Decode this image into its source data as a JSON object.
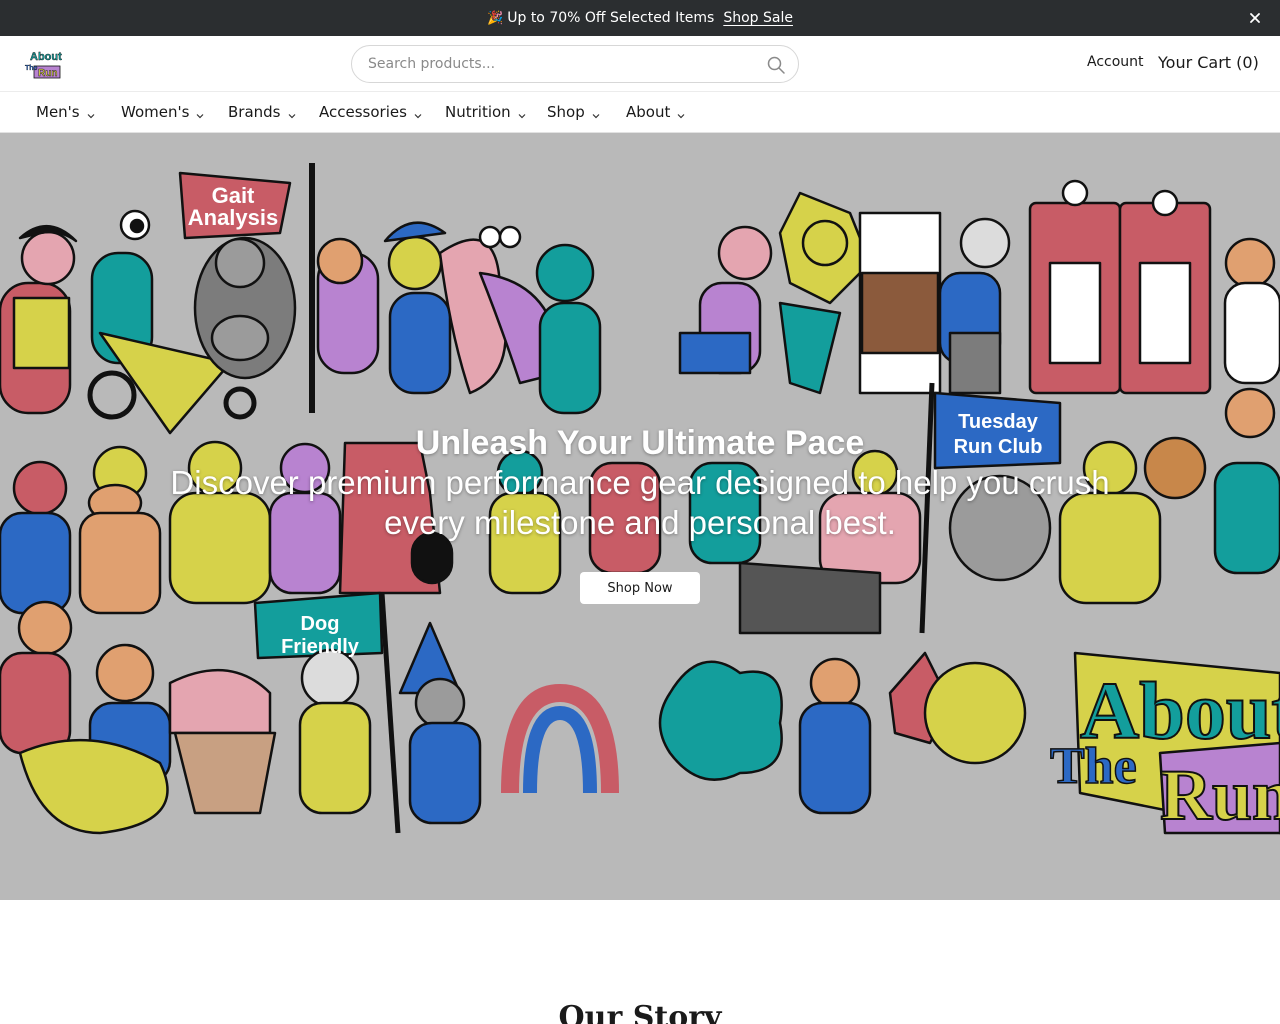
{
  "announcement": {
    "emoji": "🎉",
    "message": "Up to 70% Off Selected Items",
    "link_label": "Shop Sale",
    "close_icon": "close-icon"
  },
  "header": {
    "logo_text_top": "About",
    "logo_text_mid": "The",
    "logo_text_bottom": "Run",
    "search_placeholder": "Search products...",
    "search_icon": "search-icon",
    "account_label": "Account",
    "cart_label": "Your Cart (0)"
  },
  "nav": {
    "items": [
      {
        "label": "Men's"
      },
      {
        "label": "Women's"
      },
      {
        "label": "Brands"
      },
      {
        "label": "Accessories"
      },
      {
        "label": "Nutrition"
      },
      {
        "label": "Shop"
      },
      {
        "label": "About"
      }
    ],
    "chevron_icon": "chevron-down-icon"
  },
  "hero": {
    "title": "Unleash Your Ultimate Pace",
    "subtitle": "Discover premium performance gear designed to help you crush every milestone and personal best.",
    "button_label": "Shop Now",
    "banners": {
      "gait": [
        "Gait",
        "Analysis"
      ],
      "tuesday": [
        "Tuesday",
        "Run Club"
      ],
      "dog": [
        "Dog",
        "Friendly"
      ],
      "brand": [
        "About",
        "The",
        "Run"
      ]
    },
    "colors": {
      "background": "#b9b9b9",
      "red": "#c85c66",
      "teal": "#139e9c",
      "yellow": "#d6d24a",
      "blue": "#2c69c4",
      "purple": "#b883d0",
      "gray": "#7c7c7c",
      "pink": "#e4a5b0"
    }
  },
  "story": {
    "title": "Our Story"
  },
  "colors": {
    "announce_bg": "#2b2e30",
    "text": "#1a1a1a",
    "border": "#d7d7d7"
  }
}
